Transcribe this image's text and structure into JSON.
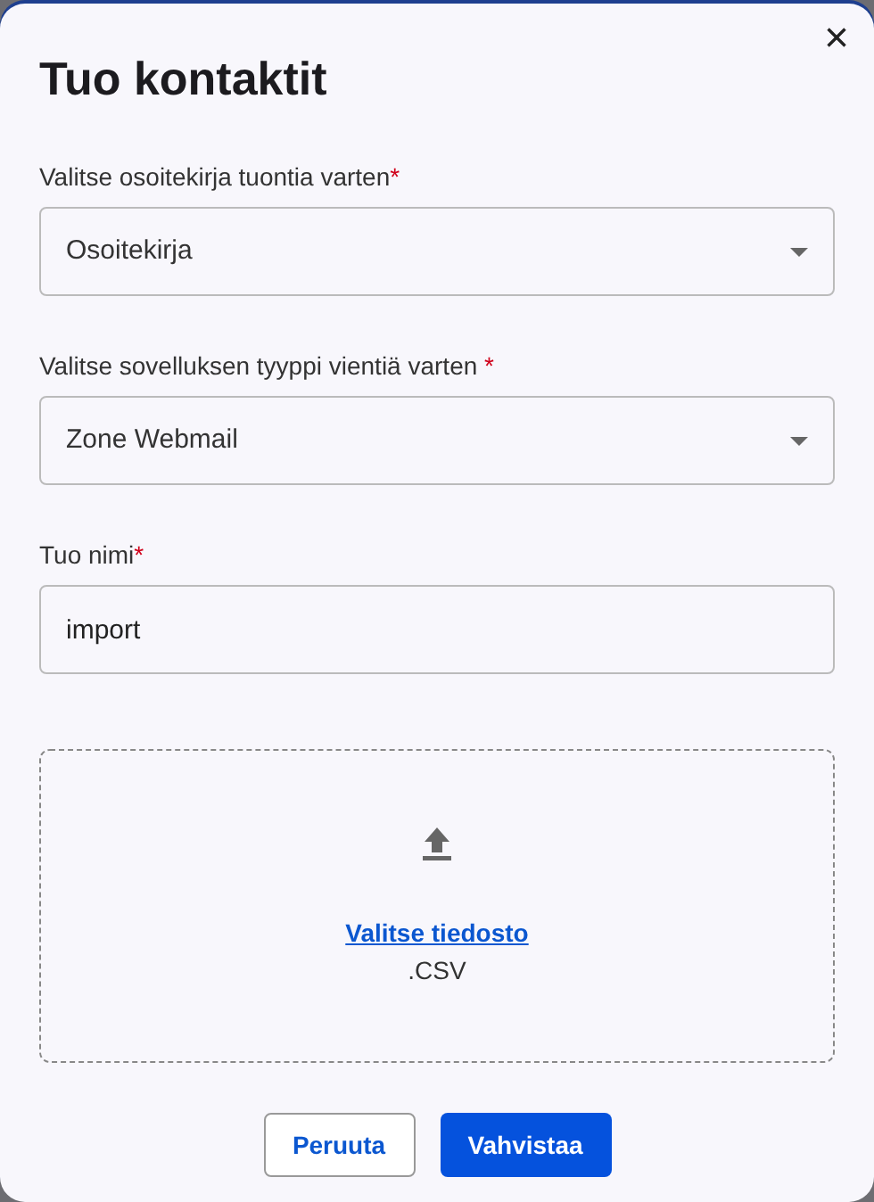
{
  "dialog": {
    "title": "Tuo kontaktit",
    "close": "×"
  },
  "fields": [
    {
      "kind": "select",
      "label": "Valitse osoitekirja tuontia varten",
      "required_mark": "*",
      "value": "Osoitekirja"
    },
    {
      "kind": "select",
      "label": "Valitse sovelluksen tyyppi vientiä varten ",
      "required_mark": "*",
      "value": "Zone Webmail"
    },
    {
      "kind": "input",
      "label": "Tuo nimi",
      "required_mark": "*",
      "value": "import"
    }
  ],
  "upload": {
    "link": "Valitse tiedosto",
    "formats": ".CSV"
  },
  "buttons": [
    {
      "kind": "secondary",
      "label": "Peruuta"
    },
    {
      "kind": "primary",
      "label": "Vahvistaa"
    }
  ]
}
